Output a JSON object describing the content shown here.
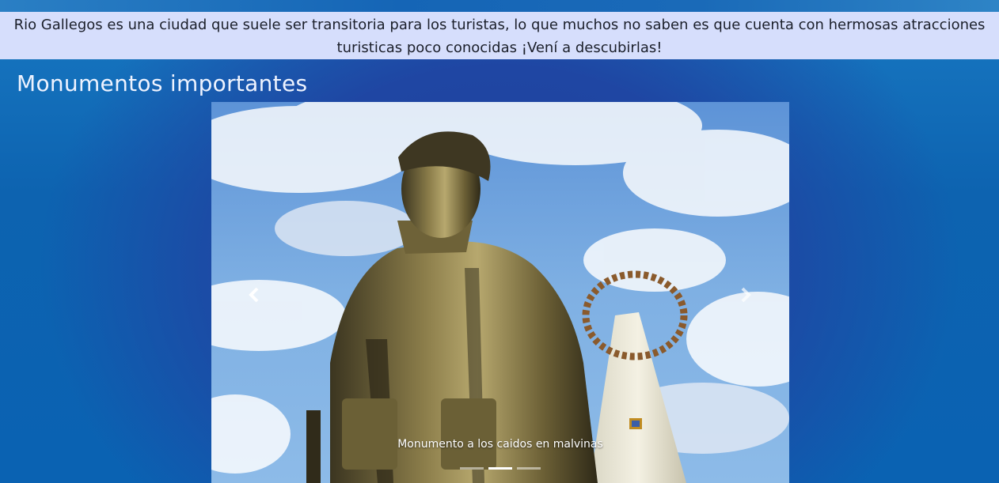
{
  "banner": {
    "text": "Rio Gallegos es una ciudad que suele ser transitoria para los turistas, lo que muchos no saben es que cuenta con hermosas atracciones turisticas poco conocidas ¡Vení a descubirlas!"
  },
  "section": {
    "title": "Monumentos importantes"
  },
  "carousel": {
    "caption": "Monumento a los caidos en malvinas",
    "slide_count": 3,
    "active_index": 1,
    "prev_icon": "chevron-left-icon",
    "next_icon": "chevron-right-icon"
  },
  "colors": {
    "banner_bg": "#d6defc",
    "page_bg": "#1f46a3",
    "title_text": "#eef3ff"
  }
}
